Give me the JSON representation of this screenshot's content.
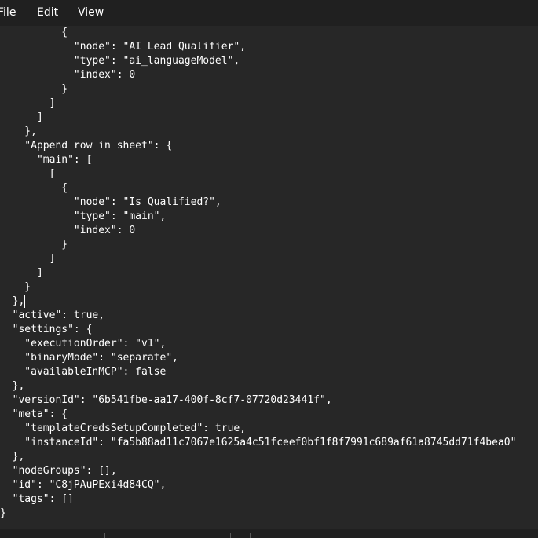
{
  "menu": {
    "file": "File",
    "edit": "Edit",
    "view": "View"
  },
  "editor": {
    "lines": [
      "          {",
      "            \"node\": \"AI Lead Qualifier\",",
      "            \"type\": \"ai_languageModel\",",
      "            \"index\": 0",
      "          }",
      "        ]",
      "      ]",
      "    },",
      "    \"Append row in sheet\": {",
      "      \"main\": [",
      "        [",
      "          {",
      "            \"node\": \"Is Qualified?\",",
      "            \"type\": \"main\",",
      "            \"index\": 0",
      "          }",
      "        ]",
      "      ]",
      "    }",
      "  },",
      "  \"active\": true,",
      "  \"settings\": {",
      "    \"executionOrder\": \"v1\",",
      "    \"binaryMode\": \"separate\",",
      "    \"availableInMCP\": false",
      "  },",
      "  \"versionId\": \"6b541fbe-aa17-400f-8cf7-07720d23441f\",",
      "  \"meta\": {",
      "    \"templateCredsSetupCompleted\": true,",
      "    \"instanceId\": \"fa5b88ad11c7067e1625a4c51fceef0bf1f8f7991c689af61a8745dd71f4bea0\"",
      "  },",
      "  \"nodeGroups\": [],",
      "  \"id\": \"C8jPAuPExi4d84CQ\",",
      "  \"tags\": []",
      "}"
    ]
  }
}
